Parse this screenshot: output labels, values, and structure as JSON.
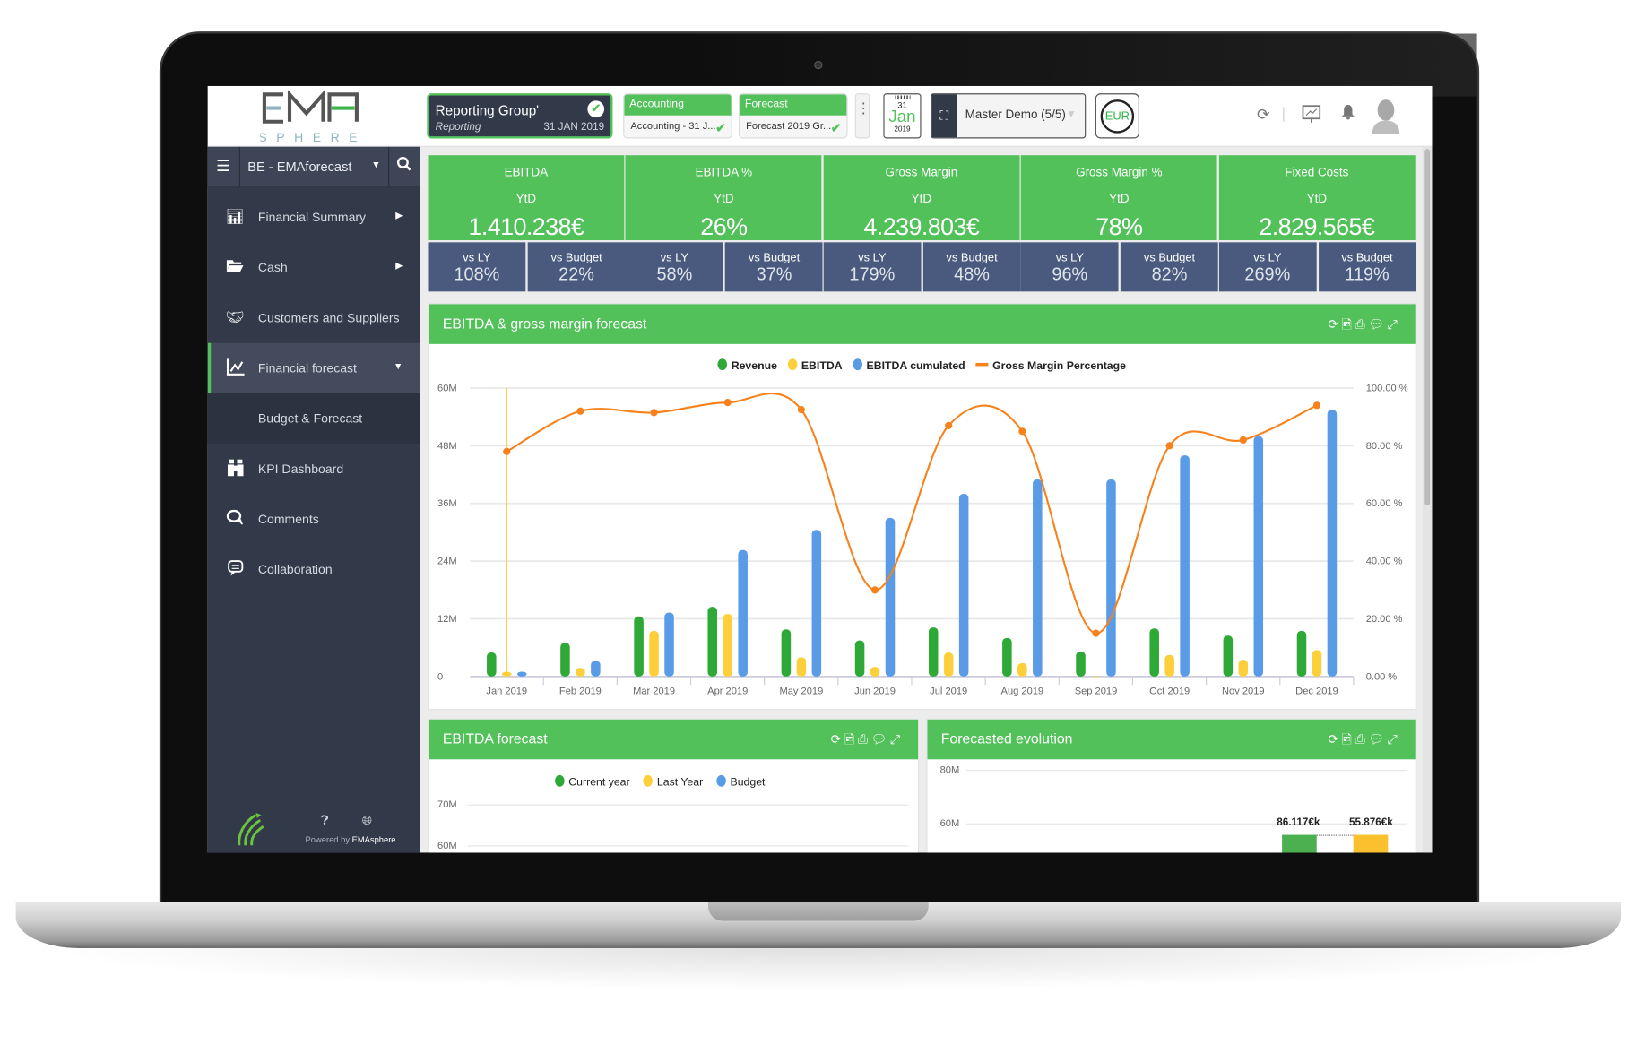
{
  "logo": {
    "text": "EMA",
    "sub": "SPHERE"
  },
  "header": {
    "reporting": {
      "title": "Reporting Group'",
      "subtitle": "Reporting",
      "date": "31 JAN 2019"
    },
    "accounting": {
      "label": "Accounting",
      "value": "Accounting - 31 J..."
    },
    "forecast": {
      "label": "Forecast",
      "value": "Forecast 2019 Gr..."
    },
    "calendar": {
      "day": "31",
      "month": "Jan",
      "year": "2019"
    },
    "company": {
      "value": "Master Demo (5/5)"
    },
    "currency": "EUR"
  },
  "sidebar": {
    "title": "BE - EMAforecast",
    "items": [
      {
        "label": "Financial Summary",
        "icon": "bar-chart-icon",
        "arrow": "right"
      },
      {
        "label": "Cash",
        "icon": "folder-icon",
        "arrow": "right"
      },
      {
        "label": "Customers and Suppliers",
        "icon": "handshake-icon"
      },
      {
        "label": "Financial forecast",
        "icon": "line-chart-icon",
        "arrow": "down",
        "active": true
      },
      {
        "label": "Budget & Forecast",
        "sub": true
      },
      {
        "label": "KPI Dashboard",
        "icon": "binoculars-icon"
      },
      {
        "label": "Comments",
        "icon": "comments-icon"
      },
      {
        "label": "Collaboration",
        "icon": "message-icon"
      }
    ],
    "footer": {
      "powered": "Powered by ",
      "brand": "EMAsphere"
    }
  },
  "kpis": [
    {
      "title": "EBITDA",
      "period": "YtD",
      "value": "1.410.238€",
      "vs_ly_label": "vs LY",
      "vs_ly": "108%",
      "vs_budget_label": "vs Budget",
      "vs_budget": "22%"
    },
    {
      "title": "EBITDA %",
      "period": "YtD",
      "value": "26%",
      "vs_ly_label": "vs LY",
      "vs_ly": "58%",
      "vs_budget_label": "vs Budget",
      "vs_budget": "37%"
    },
    {
      "title": "Gross Margin",
      "period": "YtD",
      "value": "4.239.803€",
      "vs_ly_label": "vs LY",
      "vs_ly": "179%",
      "vs_budget_label": "vs Budget",
      "vs_budget": "48%"
    },
    {
      "title": "Gross Margin %",
      "period": "YtD",
      "value": "78%",
      "vs_ly_label": "vs LY",
      "vs_ly": "96%",
      "vs_budget_label": "vs Budget",
      "vs_budget": "82%"
    },
    {
      "title": "Fixed Costs",
      "period": "YtD",
      "value": "2.829.565€",
      "vs_ly_label": "vs LY",
      "vs_ly": "269%",
      "vs_budget_label": "vs Budget",
      "vs_budget": "119%"
    }
  ],
  "colors": {
    "green": "#52c15a",
    "navy": "#4a5a7e",
    "sidebar": "#323a4a",
    "revenue": "#2ea836",
    "ebitda": "#fdd03b",
    "cumulated": "#5a9be8",
    "gm": "#f7821b"
  },
  "chart_data": [
    {
      "type": "bar+line",
      "title": "EBITDA & gross margin forecast",
      "categories": [
        "Jan 2019",
        "Feb 2019",
        "Mar 2019",
        "Apr 2019",
        "May 2019",
        "Jun 2019",
        "Jul 2019",
        "Aug 2019",
        "Sep 2019",
        "Oct 2019",
        "Nov 2019",
        "Dec 2019"
      ],
      "yticks": [
        "0",
        "12M",
        "24M",
        "36M",
        "48M",
        "60M"
      ],
      "ylim": [
        0,
        60
      ],
      "y2ticks": [
        "0.00 %",
        "20.00 %",
        "40.00 %",
        "60.00 %",
        "80.00 %",
        "100.00 %"
      ],
      "y2lim": [
        0,
        100
      ],
      "legend_position": "top",
      "grid": true,
      "series": [
        {
          "name": "Revenue",
          "type": "bar",
          "axis": "left",
          "unit": "M",
          "values": [
            5,
            7,
            12.5,
            14.5,
            9.8,
            7.5,
            10.2,
            8,
            5.2,
            10,
            8.5,
            9.5
          ]
        },
        {
          "name": "EBITDA",
          "type": "bar",
          "axis": "left",
          "unit": "M",
          "values": [
            1,
            1.8,
            9.5,
            13,
            4,
            2,
            5,
            2.8,
            0,
            4.5,
            3.5,
            5.5
          ]
        },
        {
          "name": "EBITDA cumulated",
          "type": "bar",
          "axis": "left",
          "unit": "M",
          "values": [
            1,
            3.3,
            13.3,
            26.3,
            30.5,
            33,
            38,
            41,
            41,
            46,
            50,
            55.5
          ]
        },
        {
          "name": "Gross Margin Percentage",
          "type": "line",
          "axis": "right",
          "unit": "%",
          "values": [
            78,
            92,
            91.5,
            95,
            92.5,
            30,
            87,
            85,
            15,
            80,
            82,
            94
          ]
        }
      ]
    },
    {
      "type": "bar",
      "title": "EBITDA forecast",
      "legend": [
        "Current year",
        "Last Year",
        "Budget"
      ],
      "yticks": [
        "70M",
        "60M"
      ]
    },
    {
      "type": "bar",
      "title": "Forecasted evolution",
      "yticks": [
        "80M",
        "60M"
      ],
      "labels": [
        "86.117€k",
        "55.876€k"
      ]
    }
  ]
}
